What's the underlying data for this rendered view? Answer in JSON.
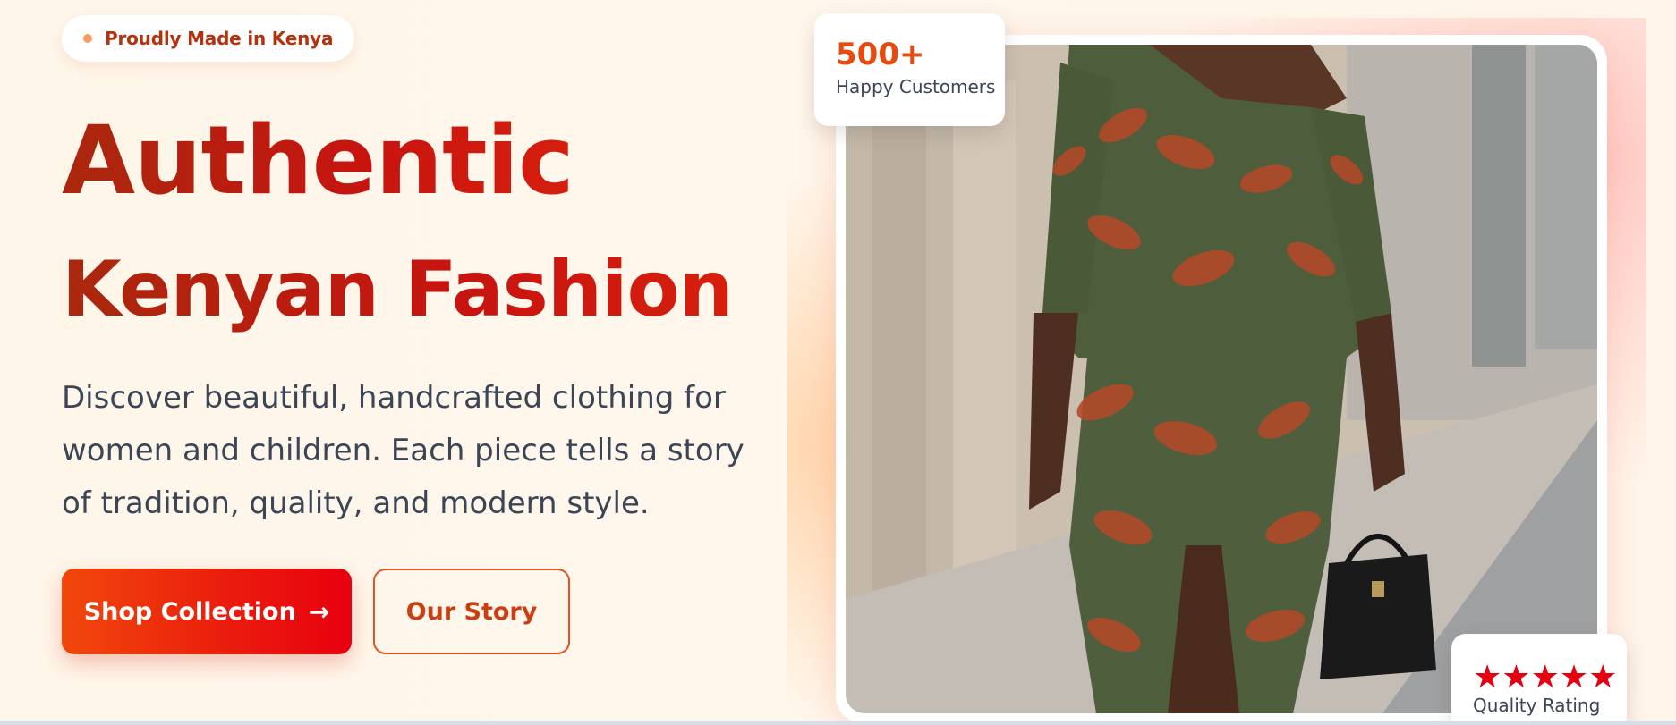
{
  "hero": {
    "badge_text": "Proudly Made in Kenya",
    "headline_line1": "Authentic",
    "headline_line2": "Kenyan Fashion",
    "description": "Discover beautiful, handcrafted clothing for women and children. Each piece tells a story of tradition, quality, and modern style.",
    "primary_button": "Shop Collection",
    "primary_button_arrow": "→",
    "secondary_button": "Our Story"
  },
  "stat_card": {
    "value": "500+",
    "label": "Happy Customers"
  },
  "rating_card": {
    "stars": 5,
    "label": "Quality Rating"
  },
  "icons": {
    "badge_dot": "dot-icon",
    "arrow": "arrow-right-icon",
    "star": "star-icon"
  },
  "colors": {
    "accent": "#e8490f",
    "headline_start": "#a9280d",
    "headline_end": "#d61f0d",
    "button_start": "#f1480b",
    "button_end": "#e8000f",
    "star": "#e5000f"
  }
}
